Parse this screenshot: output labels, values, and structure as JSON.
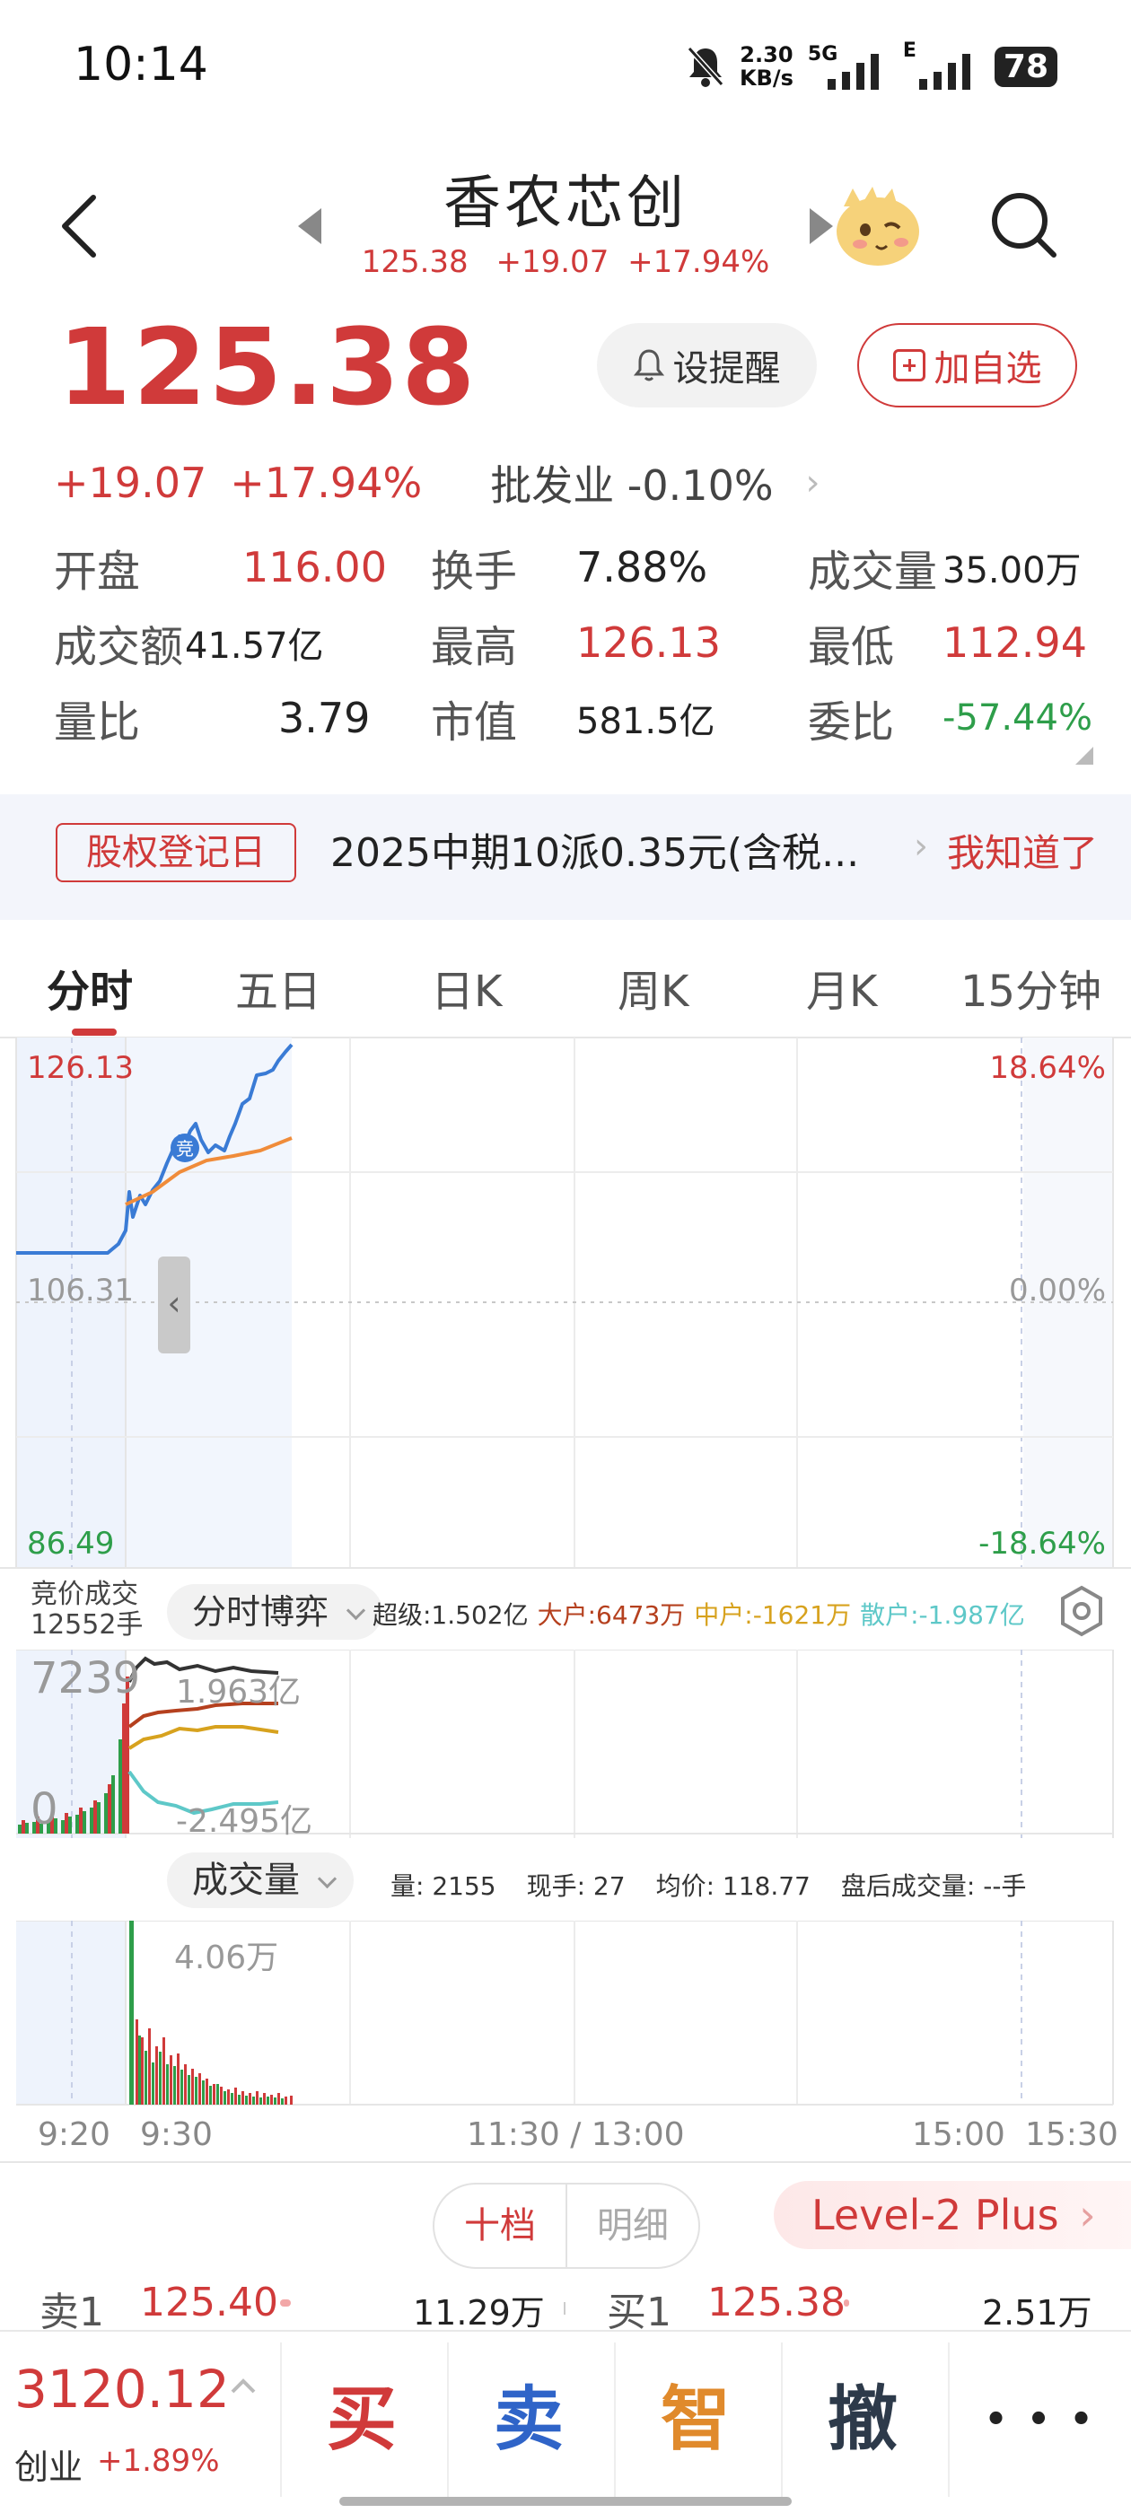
{
  "status_bar": {
    "time": "10:14",
    "net_speed_value": "2.30",
    "net_speed_unit": "KB/s",
    "signal_5g": "5G",
    "signal_e": "E",
    "battery": "78"
  },
  "header": {
    "stock_name": "香农芯创",
    "price": "125.38",
    "change": "+19.07",
    "change_pct": "+17.94%"
  },
  "quote": {
    "price": "125.38",
    "alert_label": "设提醒",
    "watch_label": "加自选",
    "change": "+19.07",
    "change_pct": "+17.94%",
    "sector": "批发业 -0.10%",
    "stats": [
      [
        {
          "label": "开盘",
          "value": "116.00"
        },
        {
          "label": "换手",
          "value": "7.88%"
        },
        {
          "label": "成交量",
          "value": "35.00万"
        }
      ],
      [
        {
          "label": "成交额",
          "value": "41.57亿"
        },
        {
          "label": "最高",
          "value": "126.13"
        },
        {
          "label": "最低",
          "value": "112.94"
        }
      ],
      [
        {
          "label": "量比",
          "value": "3.79"
        },
        {
          "label": "市值",
          "value": "581.5亿"
        },
        {
          "label": "委比",
          "value": "-57.44%"
        }
      ]
    ]
  },
  "notice": {
    "tag": "股权登记日",
    "text": "2025中期10派0.35元(含税...",
    "dismiss": "我知道了"
  },
  "tabs": [
    "分时",
    "五日",
    "日K",
    "周K",
    "月K",
    "15分钟"
  ],
  "intraday": {
    "high_price": "126.13",
    "high_pct": "18.64%",
    "mid_price": "106.31",
    "mid_pct": "0.00%",
    "low_price": "86.49",
    "low_pct": "-18.64%",
    "marker": "竞",
    "auction_label": "竞价成交",
    "auction_volume": "12552手"
  },
  "fund_flow": {
    "selector": "分时博弈",
    "super": "超级:1.502亿",
    "large": "大户:6473万",
    "medium": "中户:-1621万",
    "retail": "散户:-1.987亿",
    "axis_top": "7239",
    "axis_zero": "0",
    "max_label": "1.963亿",
    "min_label": "-2.495亿",
    "colors": {
      "super": "#333333",
      "large": "#b5401e",
      "medium": "#d7a21e",
      "retail": "#5ec8c8"
    }
  },
  "volume": {
    "selector": "成交量",
    "qty": "量: 2155",
    "hand": "现手: 27",
    "avg": "均价: 118.77",
    "after_hours": "盘后成交量: --手",
    "max_label": "4.06万"
  },
  "time_axis": [
    "9:20",
    "9:30",
    "11:30 / 13:00",
    "15:00",
    "15:30"
  ],
  "order_book": {
    "tab_active": "十档",
    "tab_other": "明细",
    "level2": "Level-2 Plus",
    "sell1_label": "卖1",
    "sell1_price": "125.40",
    "sell1_volume": "11.29万",
    "buy1_label": "买1",
    "buy1_price": "125.38",
    "buy1_volume": "2.51万"
  },
  "bottom": {
    "index_value": "3120.12",
    "index_name": "创业",
    "index_change": "+1.89%",
    "buy": "买",
    "sell": "卖",
    "smart": "智",
    "cancel": "撤",
    "more": "• • •"
  }
}
